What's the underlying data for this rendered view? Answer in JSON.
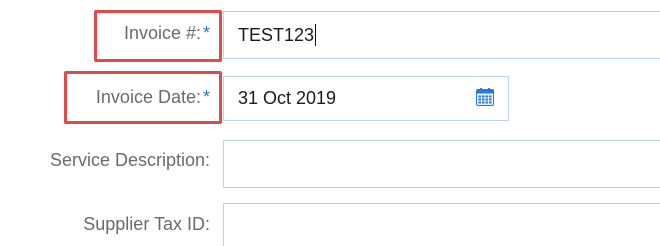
{
  "form": {
    "invoice_number": {
      "label": "Invoice #:",
      "required_mark": "*",
      "value": "TEST123"
    },
    "invoice_date": {
      "label": "Invoice Date:",
      "required_mark": "*",
      "value": "31 Oct 2019",
      "icon": "calendar-icon"
    },
    "service_description": {
      "label": "Service Description:",
      "value": ""
    },
    "supplier_tax_id": {
      "label": "Supplier Tax ID:",
      "value": ""
    }
  },
  "colors": {
    "highlight": "#dd4b4b",
    "required_asterisk": "#3e74c6",
    "field_border": "#bfd3e6",
    "calendar_icon": "#2a7bd6"
  }
}
